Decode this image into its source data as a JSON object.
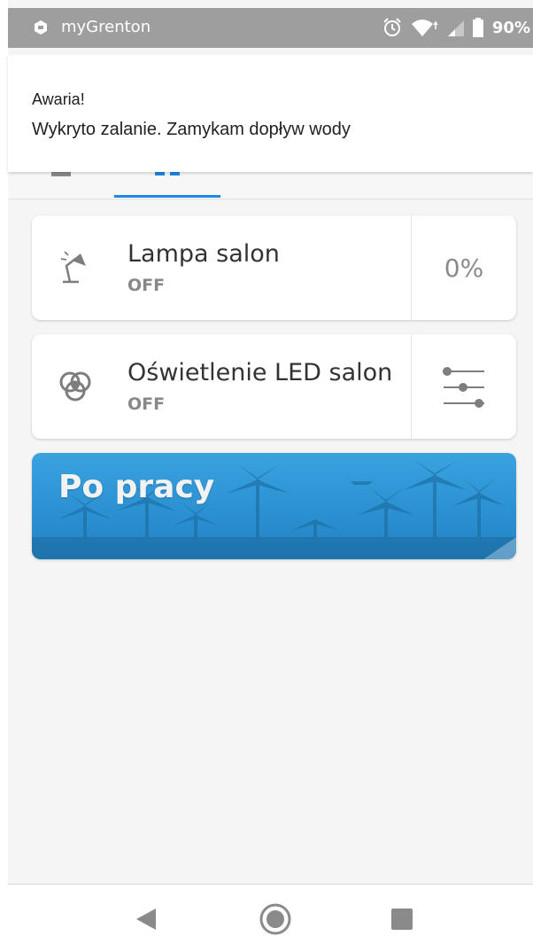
{
  "status_bar": {
    "app_name": "myGrenton",
    "battery": "90%",
    "icons": [
      "alarm-icon",
      "wifi-icon",
      "signal-icon",
      "battery-icon"
    ]
  },
  "notification": {
    "title": "Awaria!",
    "text": "Wykryto zalanie. Zamykam dopływ wody"
  },
  "devices": [
    {
      "name": "Lampa salon",
      "state": "OFF",
      "value": "0%",
      "icon": "lamp-icon"
    },
    {
      "name": "Oświetlenie LED salon",
      "state": "OFF",
      "icon": "rgb-led-icon",
      "control": "sliders-icon"
    }
  ],
  "scene": {
    "title": "Po pracy"
  },
  "colors": {
    "accent": "#1e88e5",
    "status_bar": "#9e9e9e",
    "scene_blue": "#2a8fd0"
  }
}
